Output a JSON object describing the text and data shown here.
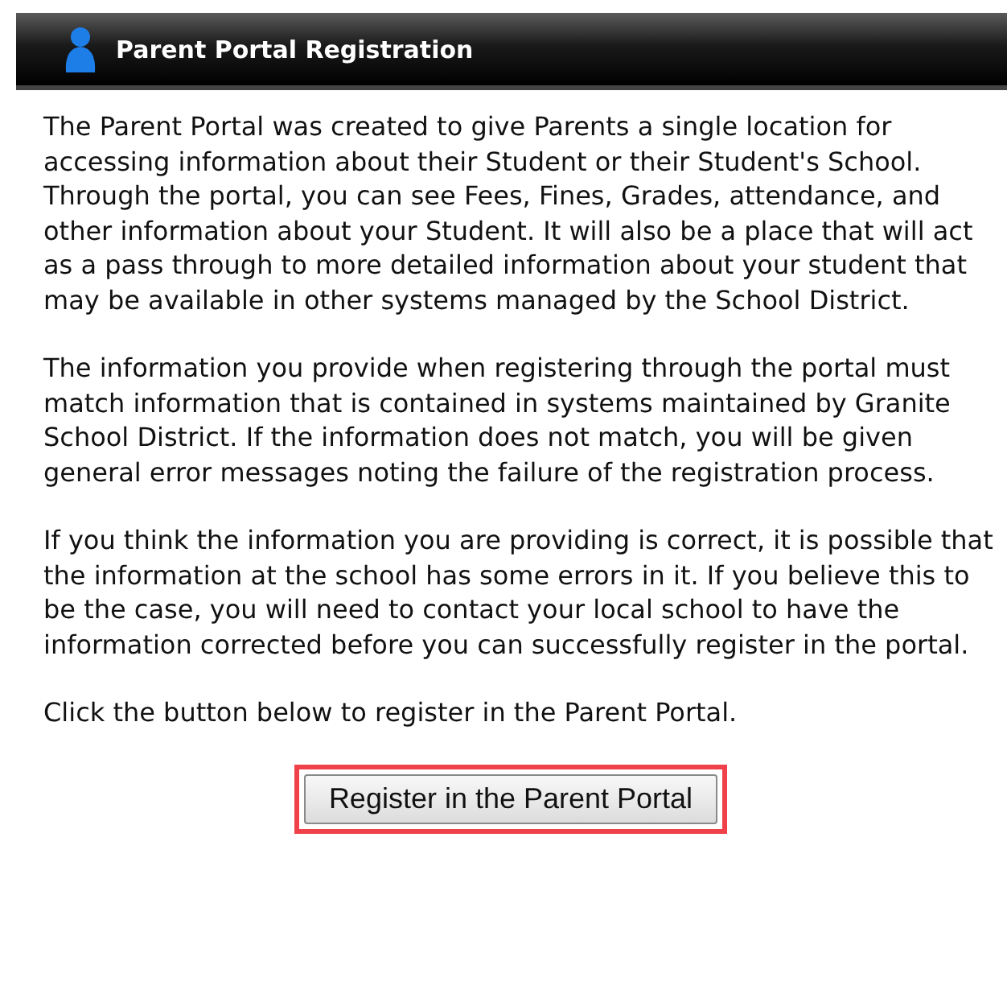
{
  "header": {
    "title": "Parent Portal Registration"
  },
  "paragraphs": [
    "The Parent Portal was created to give Parents a single location for accessing information about their Student or their Student's School. Through the portal, you can see Fees, Fines, Grades, attendance, and other information about your Student. It will also be a place that will act as a pass through to more detailed information about your student that may be available in other systems managed by the School District.",
    "The information you provide when registering through the portal must match information that is contained in systems maintained by Granite School District. If the information does not match, you will be given general error messages noting the failure of the registration process.",
    "If you think the information you are providing is correct, it is possible that the information at the school has some errors in it. If you believe this to be the case, you will need to contact your local school to have the information corrected before you can successfully register in the portal.",
    "Click the button below to register in the Parent Portal."
  ],
  "button": {
    "label": "Register in the Parent Portal",
    "highlighted": true
  }
}
